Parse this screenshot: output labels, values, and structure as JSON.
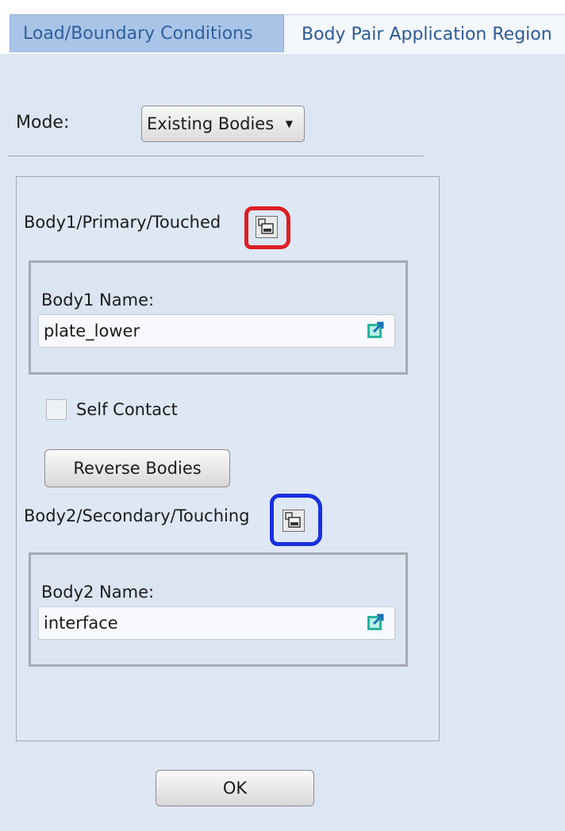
{
  "tabs": [
    {
      "label": "Load/Boundary Conditions"
    },
    {
      "label": "Body Pair Application Region"
    }
  ],
  "mode": {
    "label": "Mode:",
    "selected": "Existing Bodies"
  },
  "body1": {
    "section_label": "Body1/Primary/Touched",
    "field_label": "Body1 Name:",
    "value": "plate_lower"
  },
  "self_contact": {
    "label": "Self Contact",
    "checked": false
  },
  "reverse_button": "Reverse Bodies",
  "body2": {
    "section_label": "Body2/Secondary/Touching",
    "field_label": "Body2 Name:",
    "value": "interface"
  },
  "ok_button": "OK",
  "icons": {
    "select": "select-entity-icon",
    "link": "external-link-icon",
    "dropdown": "caret-down-icon"
  },
  "colors": {
    "highlight_red": "#dd1e24",
    "highlight_blue": "#1a2fe0",
    "link_icon": "#2bb3a0"
  }
}
